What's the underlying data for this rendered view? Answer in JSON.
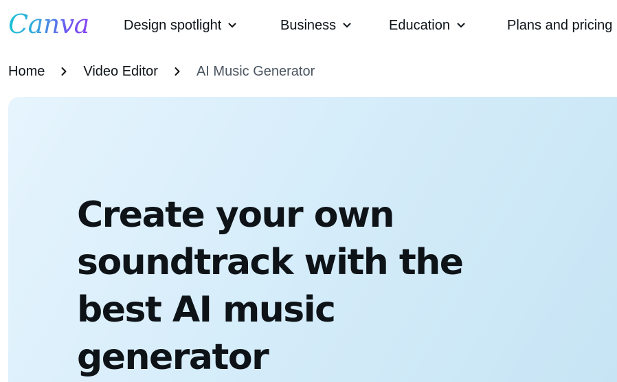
{
  "brand": {
    "logo_text": "Canva"
  },
  "nav": {
    "items": [
      {
        "label": "Design spotlight",
        "icon": "chevron-down-icon"
      },
      {
        "label": "Business",
        "icon": "chevron-down-icon"
      },
      {
        "label": "Education",
        "icon": "chevron-down-icon"
      },
      {
        "label": "Plans and pricing"
      }
    ]
  },
  "breadcrumb": {
    "items": [
      "Home",
      "Video Editor",
      "AI Music Generator"
    ],
    "separator_icon": "chevron-right-icon"
  },
  "hero": {
    "title": "Create your own soundtrack with the best AI music generator"
  },
  "colors": {
    "text": "#0e1318",
    "muted_text": "#4a5560",
    "hero_bg_start": "#e6f4fd",
    "hero_bg_end": "#c6e4f4",
    "logo_gradient_start": "#19c4d4",
    "logo_gradient_end": "#8b3df2"
  }
}
